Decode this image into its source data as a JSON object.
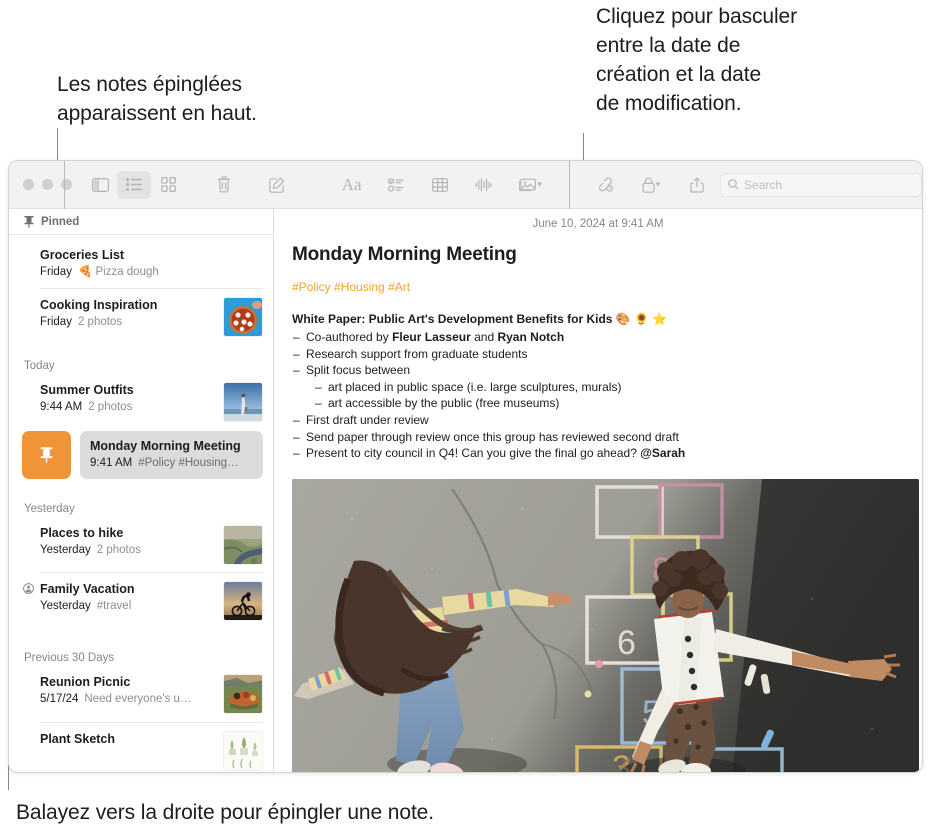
{
  "callouts": {
    "pinned_notes": "Les notes épinglées\napparaissent en haut.",
    "pinned_notes_l1": "Les notes épinglées",
    "pinned_notes_l2": "apparaissent en haut.",
    "date_toggle_l1": "Cliquez pour basculer",
    "date_toggle_l2": "entre la date de",
    "date_toggle_l3": "création et la date",
    "date_toggle_l4": "de modification.",
    "swipe_pin": "Balayez vers la droite pour épingler une note."
  },
  "toolbar": {
    "icons": {
      "sidebar": "sidebar-icon",
      "list_view": "list-view-icon",
      "gallery_view": "gallery-view-icon",
      "delete": "trash-icon",
      "compose": "compose-icon",
      "format": "Aa",
      "checklist": "checklist-icon",
      "table": "table-icon",
      "audio": "audio-waveform-icon",
      "media": "media-icon",
      "collaborate": "collaborate-icon",
      "lock": "lock-icon",
      "share": "share-icon",
      "search": "search-icon"
    },
    "search_placeholder": "Search"
  },
  "sidebar": {
    "pinned_label": "Pinned",
    "groups": [
      {
        "label": "Pinned",
        "is_pinned_header": true,
        "notes": [
          {
            "title": "Groceries List",
            "date": "Friday",
            "snippet": "🍕 Pizza dough",
            "thumb": null
          },
          {
            "title": "Cooking Inspiration",
            "date": "Friday",
            "snippet": "2 photos",
            "thumb": "pizza"
          }
        ]
      },
      {
        "label": "Today",
        "notes": [
          {
            "title": "Summer Outfits",
            "date": "9:44 AM",
            "snippet": "2 photos",
            "thumb": "beach"
          },
          {
            "title": "Monday Morning Meeting",
            "date": "9:41 AM",
            "snippet": "#Policy #Housing…",
            "thumb": null,
            "swiped": true,
            "pin_action": "pin-icon"
          }
        ]
      },
      {
        "label": "Yesterday",
        "notes": [
          {
            "title": "Places to hike",
            "date": "Yesterday",
            "snippet": "2 photos",
            "thumb": "river"
          },
          {
            "title": "Family Vacation",
            "date": "Yesterday",
            "snippet": "#travel",
            "thumb": "bike",
            "shared": true
          }
        ]
      },
      {
        "label": "Previous 30 Days",
        "notes": [
          {
            "title": "Reunion Picnic",
            "date": "5/17/24",
            "snippet": "Need everyone's u…",
            "thumb": "picnic"
          },
          {
            "title": "Plant Sketch",
            "date": "",
            "snippet": "",
            "thumb": "plants"
          }
        ]
      }
    ]
  },
  "note": {
    "date": "June 10, 2024 at 9:41 AM",
    "title": "Monday Morning Meeting",
    "tags": "#Policy #Housing #Art",
    "heading": "White Paper: Public Art's Development Benefits for Kids 🎨 🌻 ⭐",
    "bullets": [
      {
        "level": 1,
        "text": "Co-authored by ",
        "bold1": "Fleur Lasseur",
        "mid": " and ",
        "bold2": "Ryan Notch",
        "tail": ""
      },
      {
        "level": 1,
        "text": "Research support from graduate students"
      },
      {
        "level": 1,
        "text": "Split focus between"
      },
      {
        "level": 2,
        "text": "art placed in public space (i.e. large sculptures, murals)"
      },
      {
        "level": 2,
        "text": "art accessible by the public (free museums)"
      },
      {
        "level": 1,
        "text": "First draft under review"
      },
      {
        "level": 1,
        "text": "Send paper through review once this group has reviewed second draft"
      },
      {
        "level": 1,
        "text": "Present to city council in Q4! Can you give the final go ahead? ",
        "bold1": "@Sarah"
      }
    ],
    "photo_alt": "Two children playing hopscotch on chalk-drawn asphalt"
  },
  "colors": {
    "pin_action_bg": "#ef9537",
    "tag_text": "#f0a22e",
    "selected_row_bg": "#dcdcdc",
    "toolbar_bg": "#f2f2f2",
    "muted_text": "#86868b"
  }
}
